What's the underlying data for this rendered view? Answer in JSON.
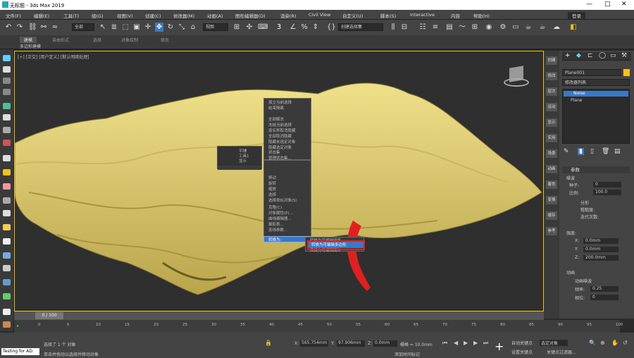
{
  "title": "无标题 - 3ds Max 2019",
  "menus": [
    "文件(F)",
    "编辑(E)",
    "工具(T)",
    "组(G)",
    "视图(V)",
    "创建(C)",
    "修改器(M)",
    "动画(A)",
    "图形编辑器(D)",
    "渲染(R)",
    "Civil View",
    "自定义(U)",
    "脚本(S)",
    "Interactive",
    "内容",
    "帮助(H)"
  ],
  "user": "登录",
  "workspace": "工作区: 默认",
  "toolbar": {
    "all_select": "全部",
    "view_select": "视图",
    "named_set": "创建选择集"
  },
  "ribbon": {
    "tabs": [
      "建模",
      "自由形式",
      "选择",
      "对象绘制",
      "填充"
    ],
    "sub": "多边形建模"
  },
  "viewport_label": "[+] [正交] [用户定义] [默认明暗处理]",
  "quad_left": {
    "items": [
      "孤立当前选择",
      "结束隔离",
      "全部解冻",
      "冻结当前选择",
      "按名称取消隐藏",
      "全部取消隐藏",
      "隐藏未选定对象",
      "隐藏选定对象",
      "状态集",
      "管理状态集..."
    ]
  },
  "quad_left_small": {
    "items": [
      "平铺",
      "工具1",
      "显示"
    ]
  },
  "quad_bottom": {
    "items": [
      "移动",
      "旋转",
      "缩放",
      "选择",
      "选择类似对象(S)",
      "克隆(C)",
      "对象属性(P)...",
      "曲线编辑器...",
      "摄影表...",
      "连线参数...",
      "转换为:"
    ]
  },
  "convert_label": "转换为:",
  "submenu": {
    "items": [
      "转换为可编辑网格",
      "转换为可编辑多边形",
      "转换为可编辑面片"
    ],
    "selected": "转换为可编辑多边形"
  },
  "right_cmds": [
    "创建",
    "修改",
    "层次",
    "运动",
    "显示",
    "实用",
    "场景",
    "动画",
    "着色",
    "变换",
    "缓存",
    "参考"
  ],
  "panel": {
    "object_name": "Plane001",
    "modifier_list": "修改器列表",
    "stack": [
      "Noise",
      "Plane"
    ],
    "params_title": "参数",
    "noise_label": "噪波",
    "seed_label": "种子:",
    "seed": "0",
    "scale_label": "比例:",
    "scale": "100.0",
    "fractal_label": "分形",
    "roughness_label": "粗糙度:",
    "iterations_label": "迭代次数:",
    "strength_title": "强度:",
    "x_label": "X:",
    "x": "0.0mm",
    "y_label": "Y:",
    "y": "0.0mm",
    "z_label": "Z:",
    "z": "200.0mm",
    "anim_title": "动画",
    "anim_noise": "动画噪波",
    "freq_label": "频率:",
    "freq": "0.25",
    "phase_label": "相位:",
    "phase": "0"
  },
  "timeline": {
    "counter": "0 / 100",
    "ticks": [
      "0",
      "5",
      "10",
      "15",
      "20",
      "25",
      "30",
      "35",
      "40",
      "45",
      "50",
      "55",
      "60",
      "65",
      "70",
      "75",
      "80",
      "85",
      "90",
      "95",
      "100"
    ]
  },
  "status": {
    "script_label": "Testing for AD:",
    "selected": "选择了 1 个 对象",
    "hint": "单击并拖动以选择并移动对象",
    "x_label": "X:",
    "x": "565.754mm",
    "y_label": "Y:",
    "y": "97.906mm",
    "z_label": "Z:",
    "z": "0.0mm",
    "grid": "栅格 = 10.0mm",
    "add_tag": "添加时间标记",
    "auto_key": "自动关键点",
    "set_key": "设置关键点",
    "select_obj": "选定对象",
    "key_filters": "关键点过滤器..."
  },
  "colors": {
    "accent": "#f0c020",
    "highlight": "#3b78c4",
    "annotation": "#e02020",
    "mesh": "#e1d27a"
  }
}
